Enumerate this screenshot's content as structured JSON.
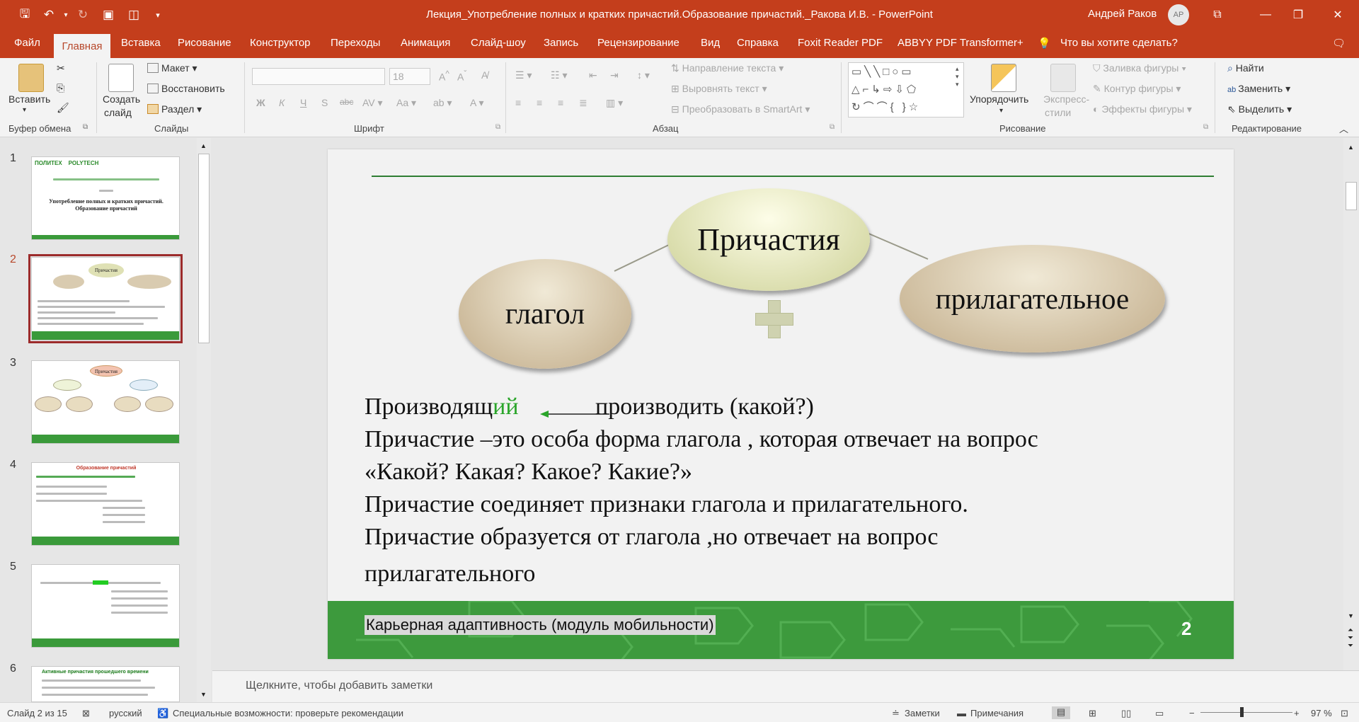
{
  "window": {
    "title": "Лекция_Употребление полных и кратких причастий.Образование причастий._Ракова И.В.  -  PowerPoint",
    "user": "Андрей Раков",
    "avatar_initials": "АР"
  },
  "tabs": [
    "Файл",
    "Главная",
    "Вставка",
    "Рисование",
    "Конструктор",
    "Переходы",
    "Анимация",
    "Слайд-шоу",
    "Запись",
    "Рецензирование",
    "Вид",
    "Справка",
    "Foxit Reader PDF",
    "ABBYY PDF Transformer+"
  ],
  "tell_me": "Что вы хотите сделать?",
  "ribbon": {
    "clipboard": {
      "paste": "Вставить",
      "label": "Буфер обмена"
    },
    "slides": {
      "new_slide_1": "Создать",
      "new_slide_2": "слайд",
      "layout": "Макет",
      "reset": "Восстановить",
      "section": "Раздел",
      "label": "Слайды"
    },
    "font": {
      "size": "18",
      "label": "Шрифт"
    },
    "paragraph": {
      "text_direction": "Направление текста",
      "align_text": "Выровнять текст",
      "smartart": "Преобразовать в SmartArt",
      "label": "Абзац"
    },
    "drawing": {
      "arrange": "Упорядочить",
      "quick_styles_1": "Экспресс-",
      "quick_styles_2": "стили",
      "fill": "Заливка фигуры",
      "outline": "Контур фигуры",
      "effects": "Эффекты фигуры",
      "label": "Рисование"
    },
    "editing": {
      "find": "Найти",
      "replace": "Заменить",
      "select": "Выделить",
      "label": "Редактирование"
    }
  },
  "thumbnails": [
    {
      "num": "1",
      "title": "Употребление полных и кратких причастий. Образование причастий"
    },
    {
      "num": "2",
      "title": "Причастия"
    },
    {
      "num": "3",
      "title": "Причастия"
    },
    {
      "num": "4",
      "title": "Образование причастий"
    },
    {
      "num": "5",
      "title": ""
    },
    {
      "num": "6",
      "title": "Активные причастия прошедшего времени"
    }
  ],
  "slide": {
    "center_node": "Причастия",
    "left_node": "глагол",
    "right_node": "прилагательное",
    "line1_a": "Производящ",
    "line1_b": "ий",
    "line1_c": "производить   (какой?)",
    "line2": "Причастие –это особа форма глагола , которая отвечает  на вопрос",
    "line3": "«Какой? Какая? Какое? Какие?»",
    "line4": "Причастие соединяет признаки глагола и прилагательного.",
    "line5": "Причастие образуется от глагола ,но отвечает на вопрос",
    "line6": "прилагательного",
    "footer": "Карьерная адаптивность (модуль мобильности)",
    "number": "2"
  },
  "notes_placeholder": "Щелкните, чтобы добавить заметки",
  "status": {
    "slide_of": "Слайд 2 из 15",
    "language": "русский",
    "accessibility": "Специальные возможности: проверьте рекомендации",
    "notes": "Заметки",
    "comments": "Примечания",
    "zoom": "97 %"
  },
  "colors": {
    "accent": "#c43e1c",
    "footer_green": "#3d9a3d",
    "selected_thumb": "#9c2b2b"
  }
}
